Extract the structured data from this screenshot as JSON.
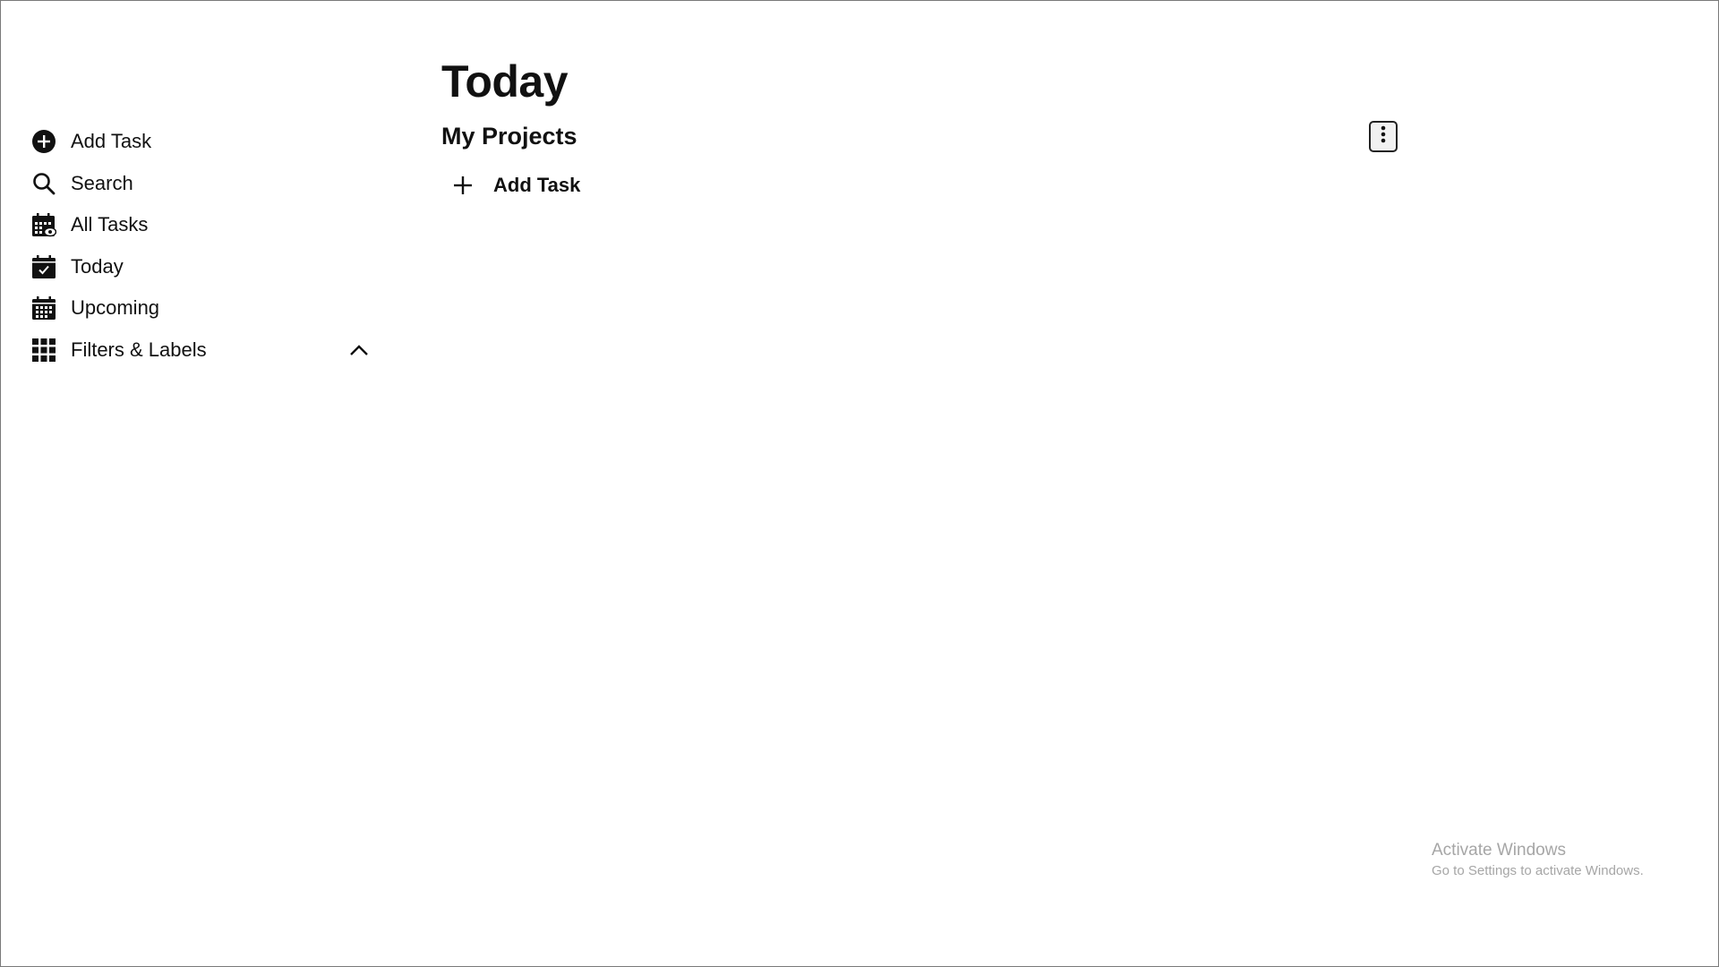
{
  "sidebar": {
    "items": [
      {
        "label": "Add Task",
        "icon": "add-circle-icon"
      },
      {
        "label": "Search",
        "icon": "search-icon"
      },
      {
        "label": "All Tasks",
        "icon": "calendar-view-icon"
      },
      {
        "label": "Today",
        "icon": "calendar-check-icon"
      },
      {
        "label": "Upcoming",
        "icon": "calendar-icon"
      },
      {
        "label": "Filters & Labels",
        "icon": "grid-icon",
        "expanded": true
      }
    ]
  },
  "main": {
    "title": "Today",
    "section": {
      "title": "My Projects",
      "menu_icon": "more-vertical-icon",
      "add_task_label": "Add Task"
    }
  },
  "watermark": {
    "title": "Activate Windows",
    "subtitle": "Go to Settings to activate Windows."
  },
  "colors": {
    "text": "#111111",
    "background": "#ffffff",
    "watermark": "#a6a6a6"
  }
}
